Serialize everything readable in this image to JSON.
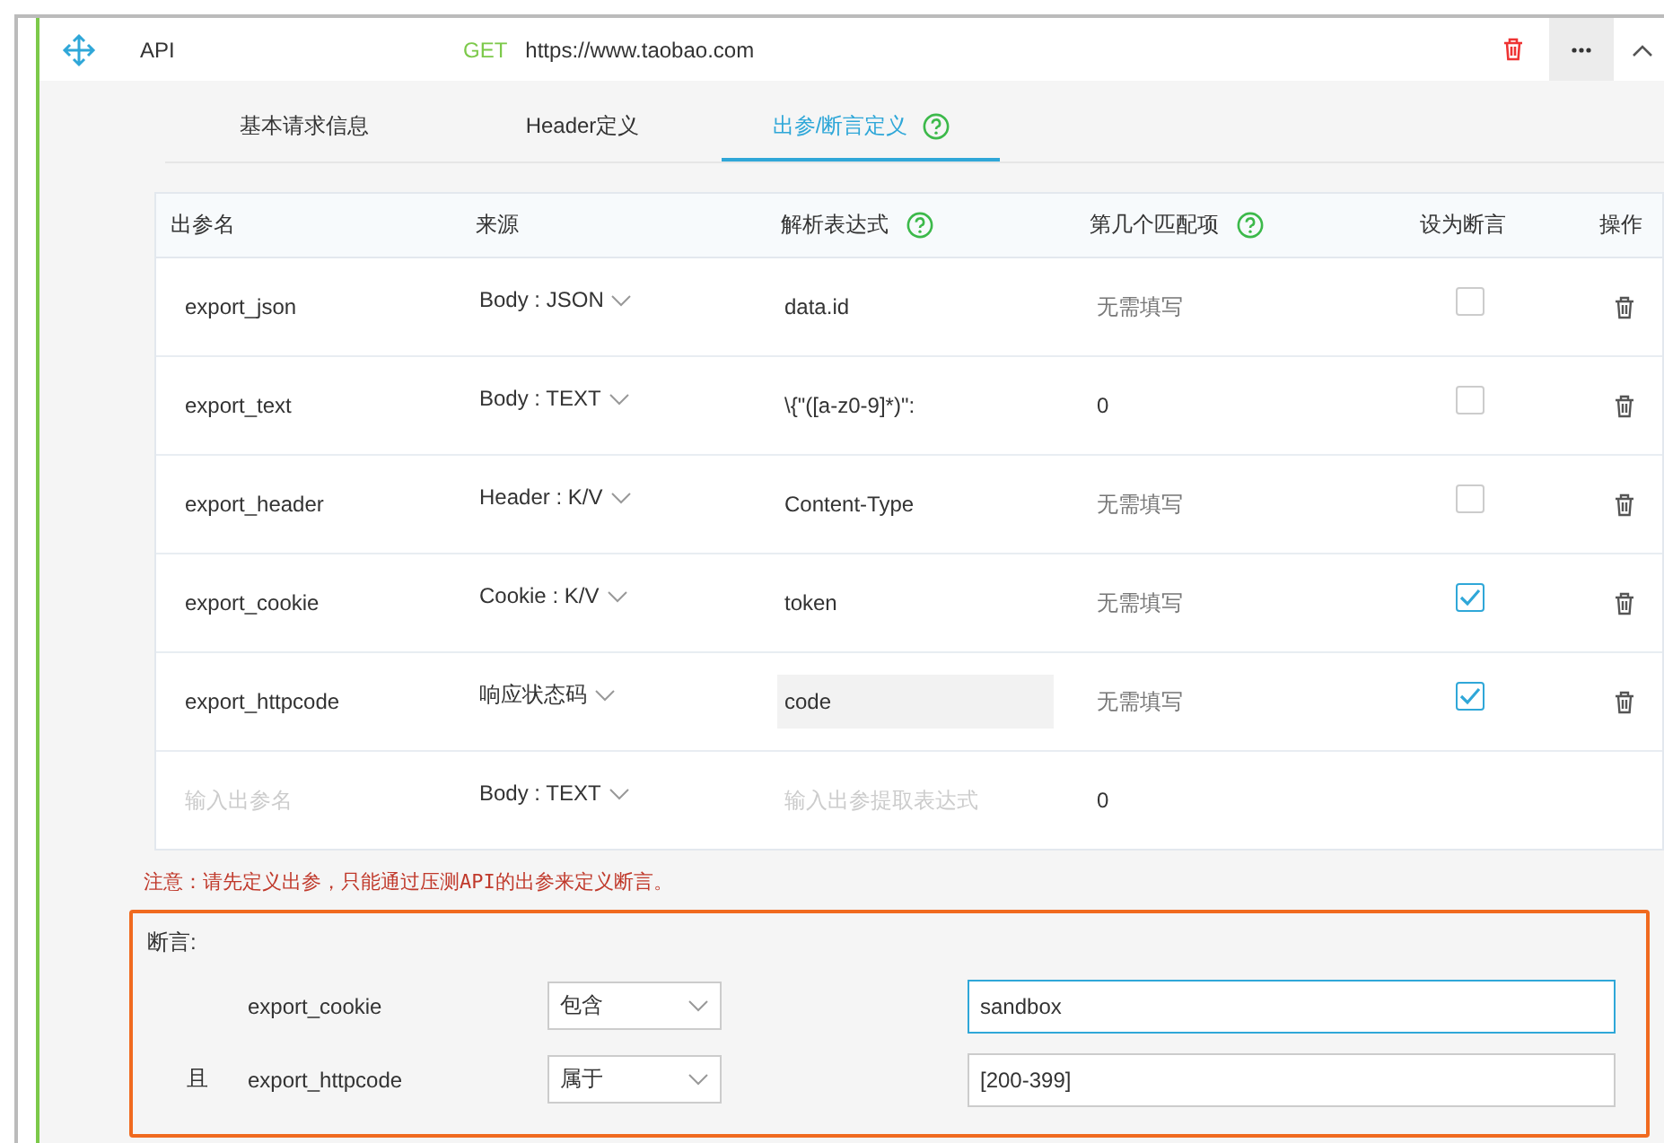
{
  "header": {
    "title": "API",
    "method": "GET",
    "url": "https://www.taobao.com"
  },
  "tabs": [
    {
      "label": "基本请求信息",
      "selected": false,
      "help": false
    },
    {
      "label": "Header定义",
      "selected": false,
      "help": false
    },
    {
      "label": "出参/断言定义",
      "selected": true,
      "help": true
    }
  ],
  "table": {
    "columns": [
      {
        "label": "出参名",
        "help": false
      },
      {
        "label": "来源",
        "help": false
      },
      {
        "label": "解析表达式",
        "help": true
      },
      {
        "label": "第几个匹配项",
        "help": true
      },
      {
        "label": "设为断言",
        "help": false
      },
      {
        "label": "操作",
        "help": false
      }
    ],
    "rows": [
      {
        "kind": "param",
        "name": "export_json",
        "source": "Body : JSON",
        "expression": "data.id",
        "expression_focused": false,
        "match": "无需填写",
        "match_disabled": true,
        "checked": false
      },
      {
        "kind": "param",
        "name": "export_text",
        "source": "Body : TEXT",
        "expression": "\\{\"([a-z0-9]*)\":",
        "expression_focused": false,
        "match": "0",
        "match_disabled": false,
        "checked": false
      },
      {
        "kind": "param",
        "name": "export_header",
        "source": "Header : K/V",
        "expression": "Content-Type",
        "expression_focused": false,
        "match": "无需填写",
        "match_disabled": true,
        "checked": false
      },
      {
        "kind": "param",
        "name": "export_cookie",
        "source": "Cookie : K/V",
        "expression": "token",
        "expression_focused": false,
        "match": "无需填写",
        "match_disabled": true,
        "checked": true
      },
      {
        "kind": "param",
        "name": "export_httpcode",
        "source": "响应状态码",
        "expression": "code",
        "expression_focused": true,
        "match": "无需填写",
        "match_disabled": true,
        "checked": true
      },
      {
        "kind": "new",
        "name_placeholder": "输入出参名",
        "source": "Body : TEXT",
        "expression_placeholder": "输入出参提取表达式",
        "match": "0",
        "match_disabled": false
      }
    ]
  },
  "note": "注意：请先定义出参，只能通过压测API的出参来定义断言。",
  "assertions": {
    "title": "断言:",
    "items": [
      {
        "name": "export_cookie",
        "operator": "包含",
        "value": "sandbox",
        "focused": true
      },
      {
        "conjunction": "且",
        "name": "export_httpcode",
        "operator": "属于",
        "value": "[200-399]",
        "focused": false
      }
    ]
  }
}
